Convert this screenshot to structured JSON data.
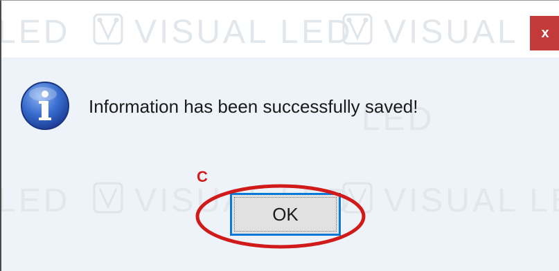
{
  "dialog": {
    "message": "Information has been successfully saved!",
    "close_label": "x",
    "ok_label": "OK",
    "watermark_text": "VISUAL LED",
    "watermark_fragment": "LED",
    "annotation_label": "C"
  },
  "colors": {
    "close_bg": "#c43a3a",
    "ok_border": "#0a78d7",
    "annotation": "#d11a1a",
    "body_bg": "#edf3f8"
  },
  "icons": {
    "info": "info-icon",
    "close": "close-icon",
    "watermark_logo": "visual-led-logo"
  }
}
